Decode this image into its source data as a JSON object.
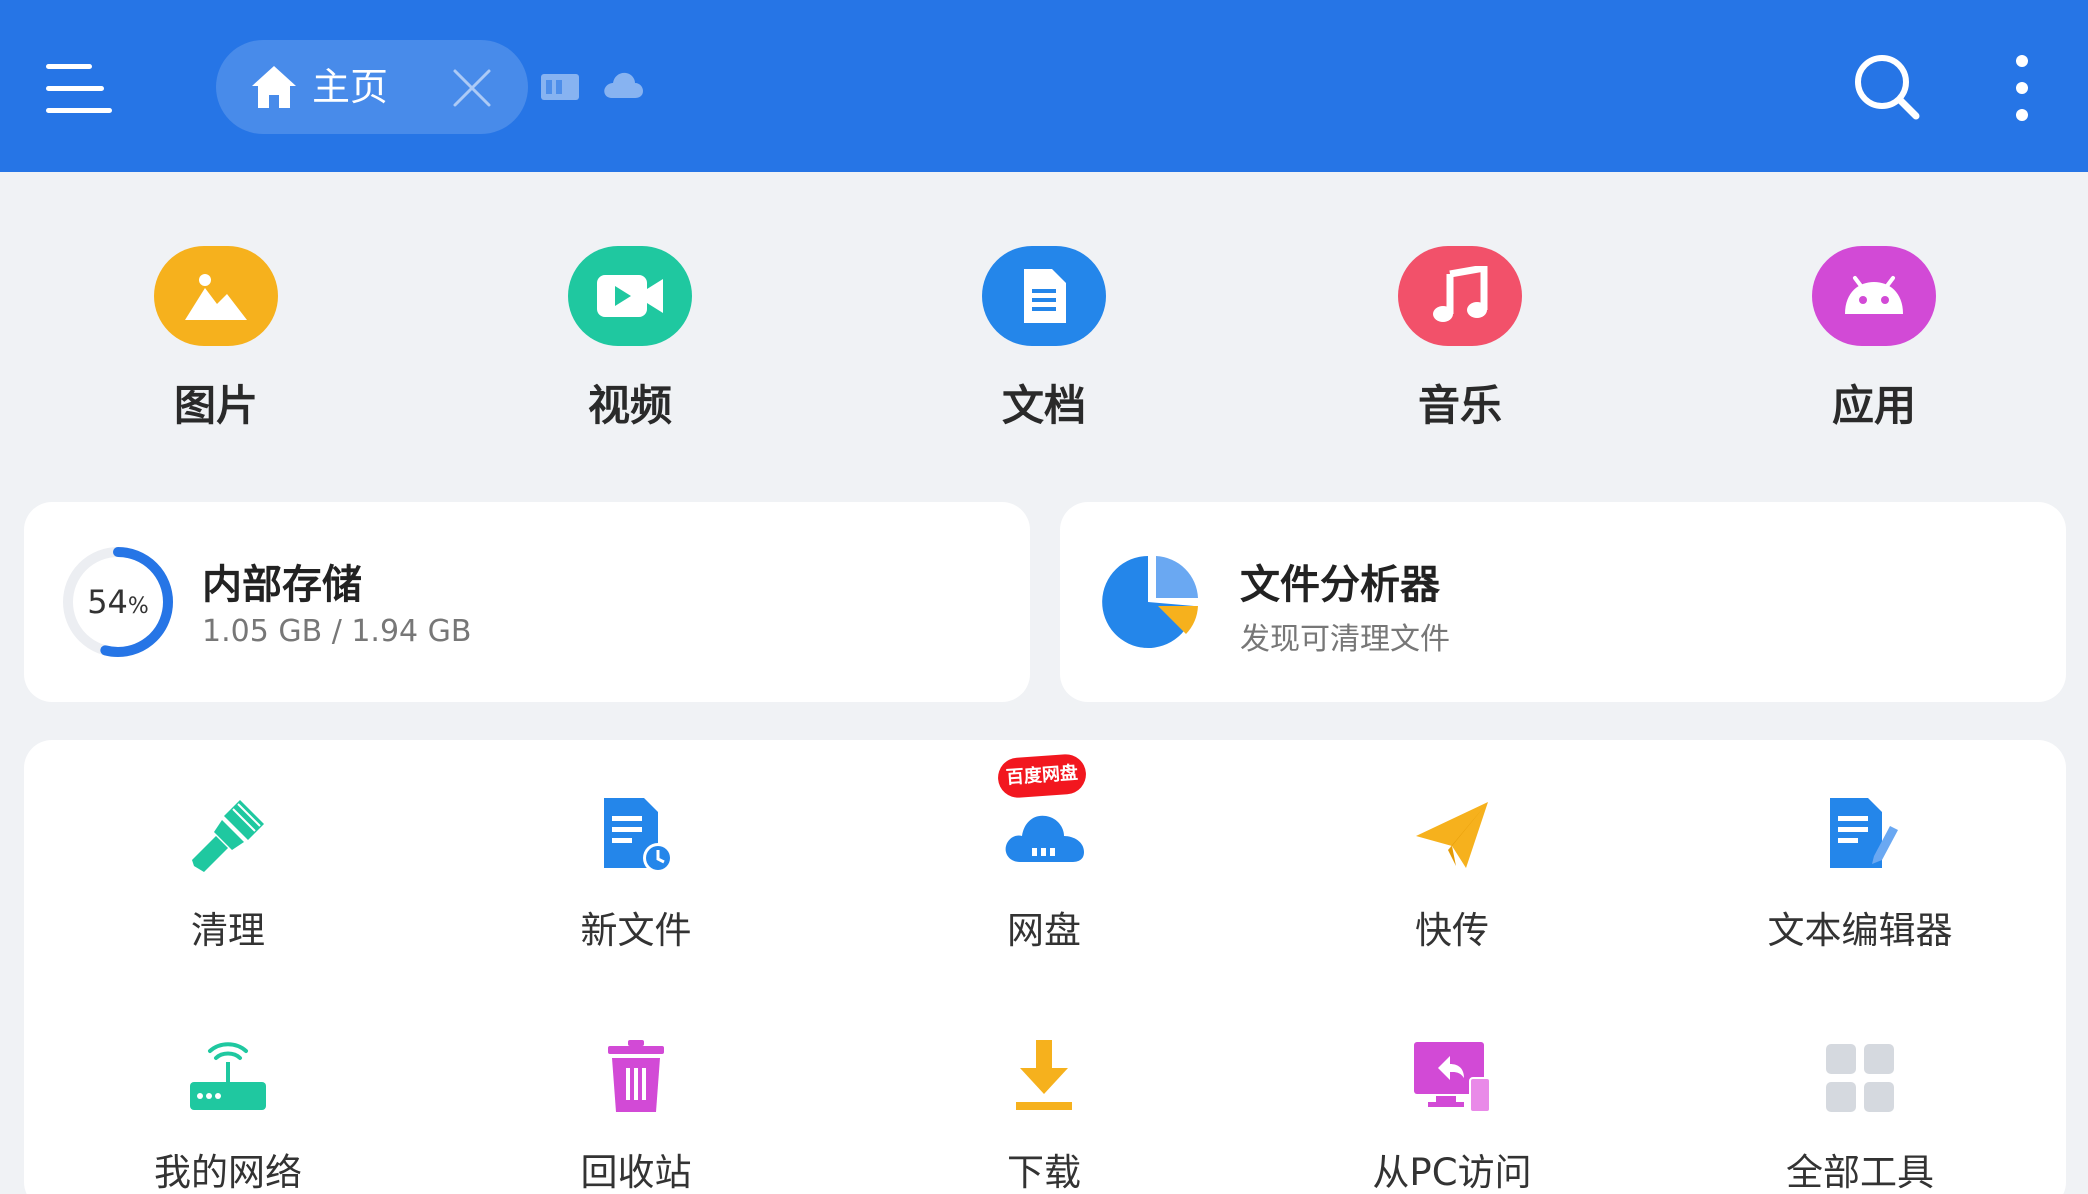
{
  "header": {
    "tab_label": "主页"
  },
  "categories": [
    {
      "label": "图片"
    },
    {
      "label": "视频"
    },
    {
      "label": "文档"
    },
    {
      "label": "音乐"
    },
    {
      "label": "应用"
    }
  ],
  "storage": {
    "title": "内部存储",
    "usage": "1.05 GB / 1.94 GB",
    "percent_value": "54",
    "percent_sign": "%",
    "fraction": 0.54
  },
  "analyzer": {
    "title": "文件分析器",
    "subtitle": "发现可清理文件"
  },
  "tools": [
    {
      "label": "清理"
    },
    {
      "label": "新文件"
    },
    {
      "label": "网盘"
    },
    {
      "label": "快传"
    },
    {
      "label": "文本编辑器"
    },
    {
      "label": "我的网络"
    },
    {
      "label": "回收站"
    },
    {
      "label": "下载"
    },
    {
      "label": "从PC访问"
    },
    {
      "label": "全部工具"
    }
  ],
  "netdisk_badge": "百度网盘",
  "colors": {
    "header": "#2675e6",
    "images": "#f6b11d",
    "video": "#1fc8a0",
    "docs": "#2486ea",
    "music": "#f2516a",
    "apps": "#d24ad6"
  }
}
